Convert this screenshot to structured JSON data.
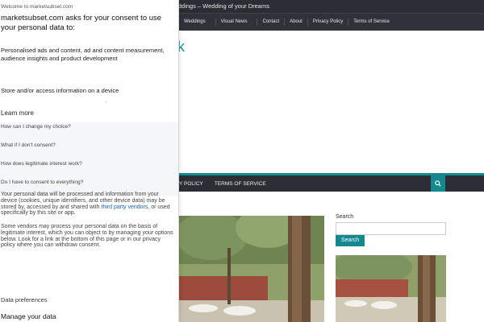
{
  "site": {
    "topbar_text": "Destination Weddings – Wedding of your Dreams",
    "top_nav": [
      "Weddings",
      "Visual News",
      "Contact",
      "About",
      "Privacy Policy",
      "Terms of Service"
    ],
    "logo_glyph": "k",
    "main_nav": [
      "Y POLICY",
      "TERMS OF SERVICE"
    ],
    "search_label": "Search",
    "search_button": "Search",
    "accent_color": "#14888f",
    "dark_nav_color": "#2b2e35"
  },
  "consent": {
    "welcome": "Welcome to marketsubset.com",
    "heading": "marketsubset.com asks for your consent to use your personal data to:",
    "purposes": [
      "Personalised ads and content, ad and content measurement, audience insights and product development",
      "Store and/or access information on a device"
    ],
    "learn_more": "Learn more",
    "faqs": [
      "How can I change my choice?",
      "What if I don't consent?",
      "How does legitimate interest work?",
      "Do I have to consent to everything?"
    ],
    "para1_before": "Your personal data will be processed and information from your device (cookies, unique identifiers, and other device data) may be stored by, accessed by and shared with ",
    "para1_link": "third party vendors",
    "para1_after": ", or used specifically by this site or app.",
    "para2": "Some vendors may process your personal data on the basis of legitimate interest, which you can object to by managing your options below. Look for a link at the bottom of this page or in our privacy policy where you can withdraw consent.",
    "data_preferences": "Data preferences",
    "manage_data": "Manage your data"
  }
}
